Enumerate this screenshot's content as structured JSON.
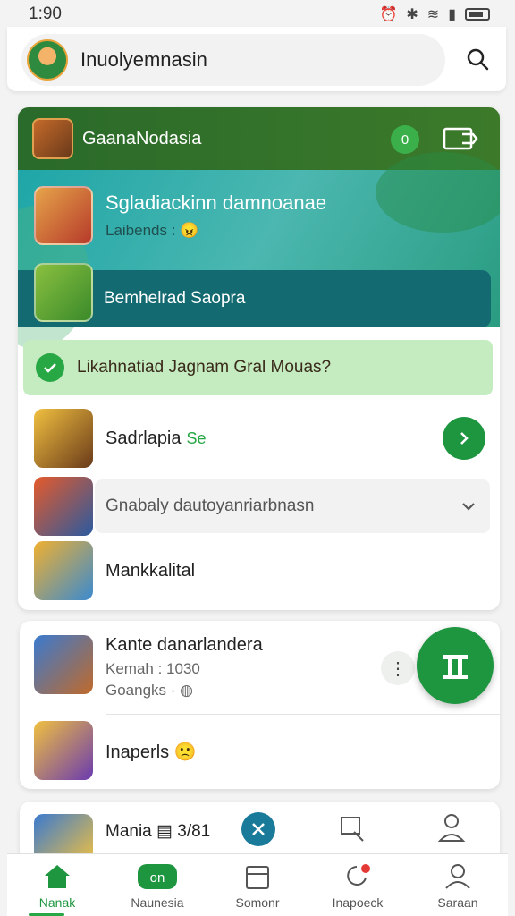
{
  "status": {
    "time": "1:90",
    "icons": [
      "alarm-icon",
      "bluetooth-icon",
      "wifi-icon",
      "signal-icon",
      "battery-icon"
    ]
  },
  "header": {
    "title": "Inuolyemnasin"
  },
  "main": {
    "head_title": "GaanaNodasia",
    "head_badge": "0",
    "featured": {
      "title": "Sgladiackinn damnoanae",
      "subtitle": "Laibends :"
    },
    "banner_label": "Bemhelrad Saopra",
    "notice": "Likahnatiad Jagnam Gral Mouas?",
    "rows": [
      {
        "label": "Sadrlapia",
        "tag": "Se"
      },
      {
        "label": "Gnabaly dautoyanriarbnasn"
      },
      {
        "label": "Mankkalital"
      }
    ]
  },
  "card2": {
    "title": "Kante danarlandera",
    "meta1": "Kemah : 1030",
    "meta2": "Goangks ·",
    "title2": "Inaperls"
  },
  "card3": {
    "title": "Mania",
    "count": "3/81"
  },
  "nav": [
    {
      "label": "Nanak",
      "icon": "home-icon"
    },
    {
      "label": "Naunesia",
      "icon": "badge-icon"
    },
    {
      "label": "Somonr",
      "icon": "store-icon"
    },
    {
      "label": "Inapoeck",
      "icon": "bell-icon"
    },
    {
      "label": "Saraan",
      "icon": "profile-icon"
    }
  ],
  "colors": {
    "accent": "#1e9640",
    "header": "#2a6a2a",
    "teal": "#1fa6a8",
    "notice": "#c4ecc0"
  }
}
